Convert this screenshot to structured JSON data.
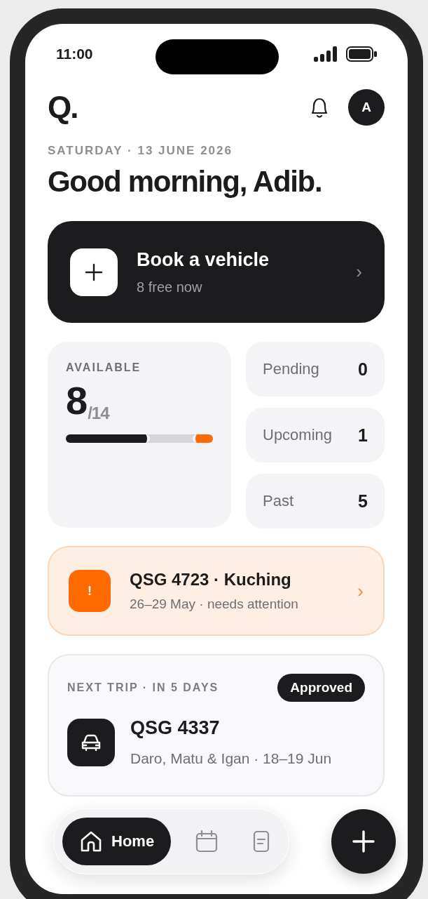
{
  "status_bar": {
    "time": "11:00"
  },
  "header": {
    "logo": "Q.",
    "avatar": "A"
  },
  "date": "SATURDAY · 13 JUNE 2026",
  "greeting": "Good morning, Adib.",
  "book_card": {
    "title": "Book a vehicle",
    "subtitle": "8 free now",
    "chevron": "›"
  },
  "availability": {
    "label": "AVAILABLE",
    "count": "8",
    "total": "/14",
    "segments": [
      {
        "kind": "free",
        "level": 0.57
      },
      {
        "kind": "attention",
        "level": 0.14
      }
    ]
  },
  "stats": [
    {
      "label": "Pending",
      "value": "0"
    },
    {
      "label": "Upcoming",
      "value": "1"
    },
    {
      "label": "Past",
      "value": "5"
    }
  ],
  "alert": {
    "icon": "!",
    "title": "QSG 4723 · Kuching",
    "subtitle": "26–29 May · needs attention",
    "chevron": "›"
  },
  "next_trip": {
    "label": "NEXT TRIP · IN 5 DAYS",
    "status": "Approved",
    "title": "QSG 4337",
    "subtitle": "Daro, Matu & Igan · 18–19 Jun"
  },
  "nav": [
    {
      "kind": "home",
      "label": "Home",
      "selected": true
    },
    {
      "kind": "calendar",
      "selected": false
    },
    {
      "kind": "document",
      "selected": false
    }
  ]
}
